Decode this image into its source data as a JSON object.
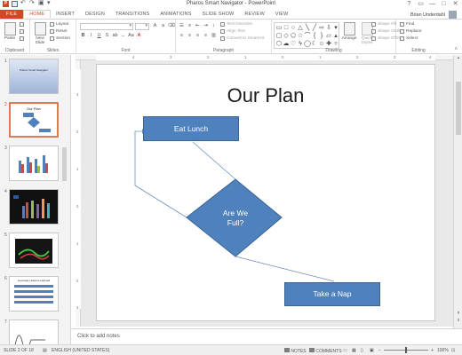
{
  "window": {
    "title": "Pharos Smart Navigator - PowerPoint",
    "controls": [
      "?",
      "▭",
      "—",
      "□",
      "✕"
    ],
    "user_name": "Brian Underdahl"
  },
  "quick_access": {
    "logo": "P"
  },
  "ribbon": {
    "tabs": [
      "FILE",
      "HOME",
      "INSERT",
      "DESIGN",
      "TRANSITIONS",
      "ANIMATIONS",
      "SLIDE SHOW",
      "REVIEW",
      "VIEW"
    ],
    "active_tab": "HOME",
    "groups": {
      "clipboard": {
        "label": "Clipboard",
        "paste": "Paste"
      },
      "slides": {
        "label": "Slides",
        "new_slide": "New Slide",
        "layout": "Layout",
        "reset": "Reset",
        "section": "Section"
      },
      "font": {
        "label": "Font"
      },
      "paragraph": {
        "label": "Paragraph",
        "text_direction": "Text Direction",
        "align_text": "Align Text",
        "convert_smartart": "Convert to SmartArt"
      },
      "drawing": {
        "label": "Drawing",
        "arrange": "Arrange",
        "quick_styles": "Quick Styles",
        "shape_fill": "Shape Fill",
        "shape_outline": "Shape Outline",
        "shape_effects": "Shape Effects"
      },
      "editing": {
        "label": "Editing",
        "find": "Find",
        "replace": "Replace",
        "select": "Select"
      }
    }
  },
  "thumbnails": [
    {
      "number": "1",
      "caption": "Pharos Smart Navigator"
    },
    {
      "number": "2",
      "caption": "Our Plan"
    },
    {
      "number": "3",
      "caption": ""
    },
    {
      "number": "4",
      "caption": ""
    },
    {
      "number": "5",
      "caption": ""
    },
    {
      "number": "6",
      "caption": "Leverage Lessons Learned"
    },
    {
      "number": "7",
      "caption": ""
    }
  ],
  "ruler": {
    "horizontal": [
      "4",
      "3",
      "2",
      "1",
      "0",
      "1",
      "2",
      "3",
      "4"
    ],
    "vertical": [
      "3",
      "2",
      "1",
      "0",
      "1",
      "2",
      "3"
    ]
  },
  "slide": {
    "title": "Our Plan",
    "shapes": {
      "eat_lunch": "Eat Lunch",
      "decision_line1": "Are We",
      "decision_line2": "Full?",
      "take_nap": "Take a Nap"
    },
    "shape_color": "#4f81bd"
  },
  "notes_placeholder": "Click to add notes",
  "status": {
    "slide_info": "SLIDE 2 OF 18",
    "language": "ENGLISH (UNITED STATES)",
    "notes": "NOTES",
    "comments": "COMMENTS",
    "zoom": "100%"
  }
}
